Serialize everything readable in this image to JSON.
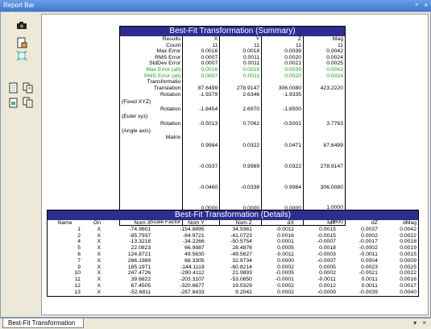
{
  "window": {
    "title": "Report Bar",
    "pin_glyph": "ᵖ",
    "close_glyph": "×"
  },
  "toolbar": {
    "icons": [
      "camera-icon",
      "page-setup-icon",
      "fit-page-icon",
      "single-page-icon",
      "multi-page-icon",
      "print-icon",
      "copy-pages-icon"
    ]
  },
  "summary": {
    "title": "Best-Fit Transformation (Summary)",
    "rows": [
      {
        "label": "Results",
        "x": "X",
        "y": "Y",
        "z": "Z",
        "mag": "Mag"
      },
      {
        "label": "Count",
        "x": "11",
        "y": "11",
        "z": "11",
        "mag": "11"
      },
      {
        "label": "Max Error",
        "x": "0.0016",
        "y": "0.0018",
        "z": "0.0039",
        "mag": "0.0042"
      },
      {
        "label": "RMS Error",
        "x": "0.0007",
        "y": "0.0011",
        "z": "0.0020",
        "mag": "0.0024"
      },
      {
        "label": "StdDev Error",
        "x": "0.0007",
        "y": "0.0011",
        "z": "0.0021",
        "mag": "0.0025"
      },
      {
        "label": "Max Error (all)",
        "x": "0.0016",
        "y": "0.0018",
        "z": "0.0039",
        "mag": "0.0042"
      },
      {
        "label": "RMS Error (all)",
        "x": "0.0007",
        "y": "0.0011",
        "z": "0.0020",
        "mag": "0.0024"
      }
    ],
    "transform_label": "Transformatio",
    "translation": {
      "label": "Translation",
      "x": "87.6499",
      "y": "278.9147",
      "z": "306.0080",
      "mag": "423.2220"
    },
    "rot_fixed": {
      "label1": "Rotation",
      "label2": "(Fixed XYZ)",
      "x": "-1.9379",
      "y": "2.6346",
      "z": "-1.9335",
      "mag": ""
    },
    "rot_euler": {
      "label1": "Rotation",
      "label2": "(Euler xyz)",
      "x": "-1.8454",
      "y": "2.6970",
      "z": "-1.8500",
      "mag": ""
    },
    "rot_angle": {
      "label1": "Rotation",
      "label2": "(Angle axis)",
      "x": "-0.5013",
      "y": "0.7062",
      "z": "-0.5001",
      "mag": "3.7763"
    },
    "matrix_label": "Matrix",
    "matrix": [
      [
        "0.9984",
        "0.0322",
        "0.0471",
        "87.6499"
      ],
      [
        "-0.0337",
        "0.9989",
        "0.0322",
        "278.9147"
      ],
      [
        "-0.0460",
        "-0.0338",
        "0.9984",
        "306.0080"
      ],
      [
        "0.0000",
        "0.0000",
        "0.0000",
        "1.0000"
      ]
    ],
    "scale": {
      "label": "Scale Factor",
      "value": "1.0000"
    }
  },
  "details": {
    "title": "Best-Fit Transformation (Details)",
    "columns": [
      "Name",
      "On",
      "Nom X",
      "Nom Y",
      "Nom Z",
      "dX",
      "dY",
      "dZ",
      "dMag"
    ],
    "rows": [
      [
        "1",
        "X",
        "-74.9601",
        "-154.8895",
        "34.9361",
        "-0.0011",
        "0.0015",
        "0.0037",
        "0.0042"
      ],
      [
        "2",
        "X",
        "-85.7937",
        "-84.9721",
        "-41.0723",
        "0.0016",
        "-0.0015",
        "0.0002",
        "0.0022"
      ],
      [
        "4",
        "X",
        "-13.3218",
        "-34.2266",
        "-50.5754",
        "0.0001",
        "-0.0007",
        "-0.0017",
        "0.0018"
      ],
      [
        "5",
        "X",
        "22.0823",
        "66.9987",
        "28.4876",
        "0.0005",
        "0.0018",
        "-0.0002",
        "0.0019"
      ],
      [
        "6",
        "X",
        "124.8721",
        "49.5630",
        "-49.5627",
        "-0.0011",
        "-0.0003",
        "-0.0011",
        "0.0015"
      ],
      [
        "7",
        "X",
        "266.1989",
        "68.3305",
        "32.9734",
        "0.0000",
        "-0.0007",
        "0.0004",
        "0.0009"
      ],
      [
        "9",
        "X",
        "185.1971",
        "-144.1119",
        "-60.8214",
        "0.0002",
        "0.0005",
        "0.0023",
        "0.0025"
      ],
      [
        "10",
        "X",
        "247.4726",
        "-290.4112",
        "21.9893",
        "-0.0005",
        "0.0002",
        "-0.0021",
        "0.0022"
      ],
      [
        "11",
        "X",
        "39.6822",
        "-203.3107",
        "-53.0850",
        "-0.0001",
        "-0.0011",
        "0.0011",
        "0.0016"
      ],
      [
        "12",
        "X",
        "67.4505",
        "-320.6677",
        "19.5329",
        "0.0002",
        "0.0012",
        "0.0011",
        "0.0017"
      ],
      [
        "13",
        "X",
        "-52.6811",
        "-287.8433",
        "9.2042",
        "0.0002",
        "-0.0009",
        "-0.0039",
        "0.0040"
      ]
    ]
  },
  "bottom": {
    "tab_label": "Best-Fit Transformation",
    "dropdown_glyph": "▾",
    "close_glyph": "×"
  }
}
